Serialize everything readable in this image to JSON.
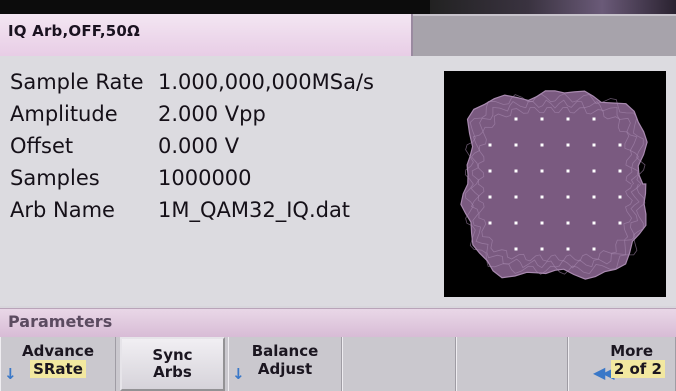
{
  "header": {
    "title": "IQ Arb,OFF,50Ω"
  },
  "parameters": [
    {
      "label": "Sample Rate",
      "value": "1.000,000,000MSa/s"
    },
    {
      "label": "Amplitude",
      "value": "2.000 Vpp"
    },
    {
      "label": "Offset",
      "value": "0.000 V"
    },
    {
      "label": "Samples",
      "value": "1000000"
    },
    {
      "label": "Arb Name",
      "value": "1M_QAM32_IQ.dat"
    }
  ],
  "section_bar": {
    "title": "Parameters"
  },
  "softkeys": {
    "advance": {
      "line1": "Advance",
      "line2": "SRate"
    },
    "sync_arbs": {
      "line1": "Sync",
      "line2": "Arbs"
    },
    "balance_adjust": {
      "line1": "Balance",
      "line2": "Adjust"
    },
    "more": {
      "line1": "More",
      "line2": "2 of 2"
    }
  },
  "constellation": {
    "grid_size": 6,
    "missing_corners": true
  },
  "colors": {
    "tab_active": "#e8cde6",
    "constellation_fill": "#7a5a80",
    "constellation_trace": "#a98ab0",
    "arrow_blue": "#3a78c8",
    "highlight": "#f2e8a0"
  }
}
